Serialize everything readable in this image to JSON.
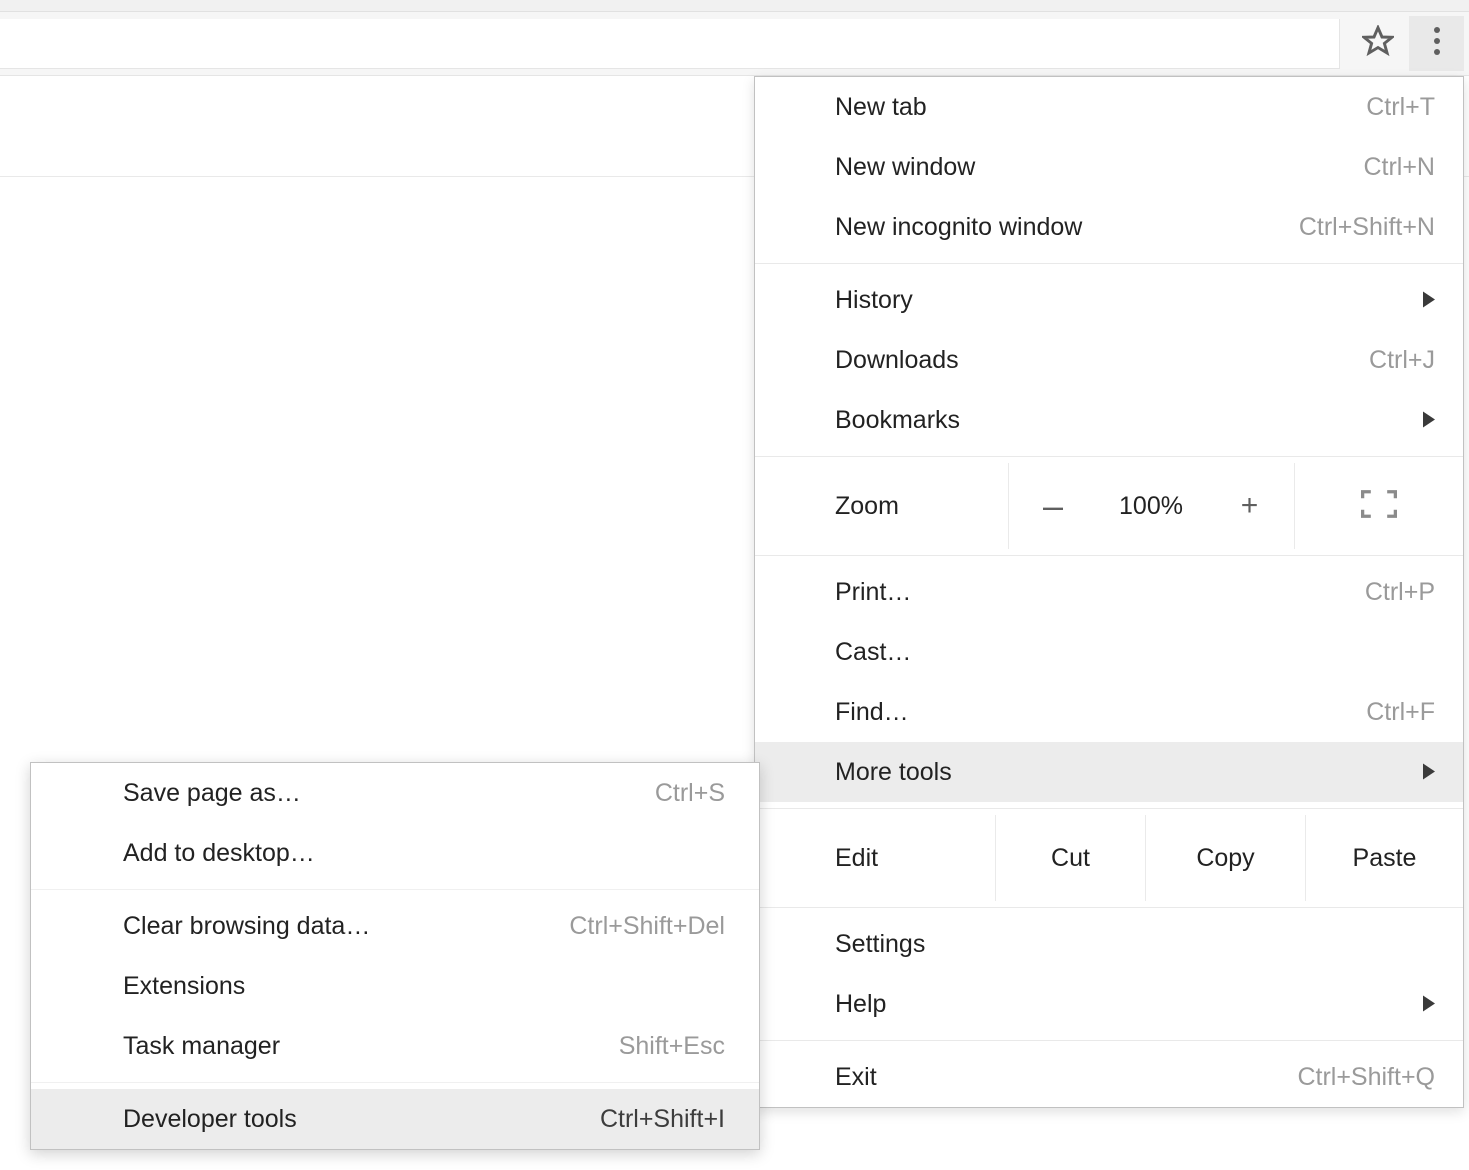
{
  "main_menu": {
    "group1": [
      {
        "label": "New tab",
        "shortcut": "Ctrl+T"
      },
      {
        "label": "New window",
        "shortcut": "Ctrl+N"
      },
      {
        "label": "New incognito window",
        "shortcut": "Ctrl+Shift+N"
      }
    ],
    "group2": [
      {
        "label": "History",
        "submenu": true
      },
      {
        "label": "Downloads",
        "shortcut": "Ctrl+J"
      },
      {
        "label": "Bookmarks",
        "submenu": true
      }
    ],
    "zoom": {
      "label": "Zoom",
      "value": "100%"
    },
    "group3": [
      {
        "label": "Print…",
        "shortcut": "Ctrl+P"
      },
      {
        "label": "Cast…"
      },
      {
        "label": "Find…",
        "shortcut": "Ctrl+F"
      },
      {
        "label": "More tools",
        "submenu": true,
        "hover": true
      }
    ],
    "edit": {
      "label": "Edit",
      "cut": "Cut",
      "copy": "Copy",
      "paste": "Paste"
    },
    "group4": [
      {
        "label": "Settings"
      },
      {
        "label": "Help",
        "submenu": true
      }
    ],
    "group5": [
      {
        "label": "Exit",
        "shortcut": "Ctrl+Shift+Q"
      }
    ]
  },
  "sub_menu": {
    "group1": [
      {
        "label": "Save page as…",
        "shortcut": "Ctrl+S"
      },
      {
        "label": "Add to desktop…"
      }
    ],
    "group2": [
      {
        "label": "Clear browsing data…",
        "shortcut": "Ctrl+Shift+Del"
      },
      {
        "label": "Extensions"
      },
      {
        "label": "Task manager",
        "shortcut": "Shift+Esc"
      }
    ],
    "group3": [
      {
        "label": "Developer tools",
        "shortcut": "Ctrl+Shift+I",
        "hover": true
      }
    ]
  }
}
